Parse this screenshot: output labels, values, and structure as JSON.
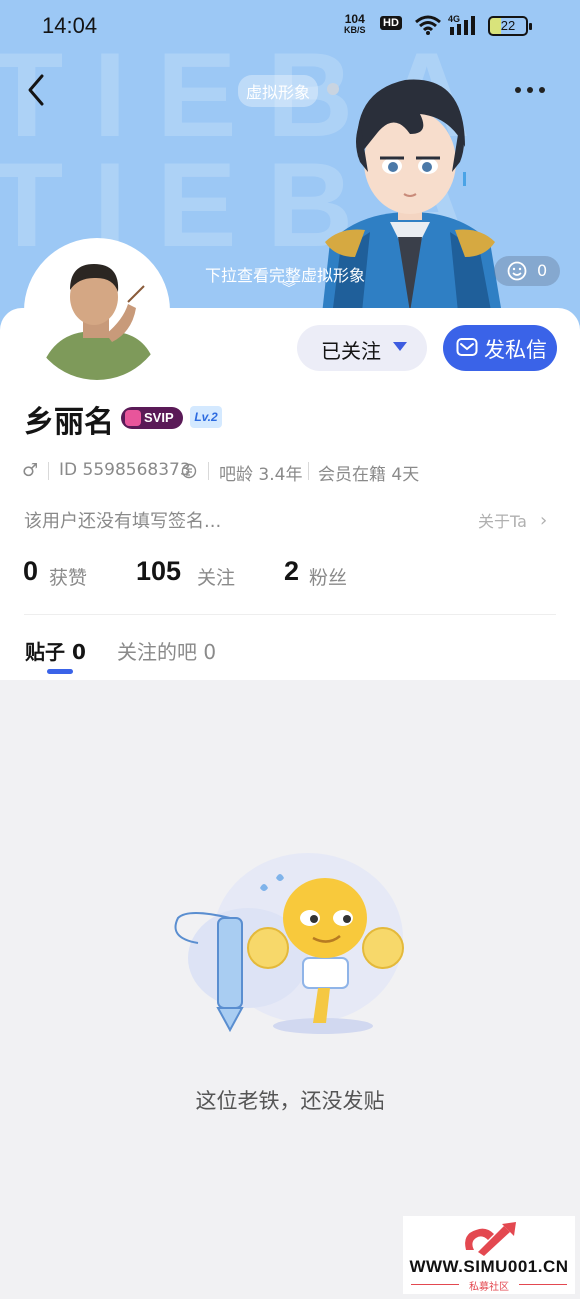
{
  "status_bar": {
    "time": "14:04",
    "net_speed": "104",
    "net_unit": "KB/S",
    "hd_label": "HD",
    "signal_label": "4G",
    "battery": "22"
  },
  "header": {
    "avatar_tag": "虚拟形象",
    "pull_hint": "下拉查看完整虚拟形象",
    "emoji_count": "0",
    "watermark": "TIEBA TIEBA"
  },
  "profile": {
    "username": "乡丽名",
    "svip_label": "SVIP",
    "level_label": "Lv.2",
    "gender_symbol": "♂",
    "id_text": "ID 5598568373",
    "age_text": "吧龄 3.4年",
    "member_text": "会员在籍 4天",
    "signature": "该用户还没有填写签名...",
    "about_label": "关于Ta"
  },
  "actions": {
    "follow_label": "已关注",
    "dm_label": "发私信"
  },
  "stats": [
    {
      "value": "0",
      "label": "获赞"
    },
    {
      "value": "105",
      "label": "关注"
    },
    {
      "value": "2",
      "label": "粉丝"
    }
  ],
  "tabs": [
    {
      "label": "贴子",
      "count": "0"
    },
    {
      "label": "关注的吧",
      "count": "0"
    }
  ],
  "empty_state": {
    "message": "这位老铁，还没发贴"
  },
  "watermark": {
    "site": "WWW.SIMU001.CN",
    "sub": "私募社区"
  },
  "colors": {
    "banner": "#9cc8f5",
    "accent": "#3a63e8",
    "svip": "#5a1a57"
  }
}
